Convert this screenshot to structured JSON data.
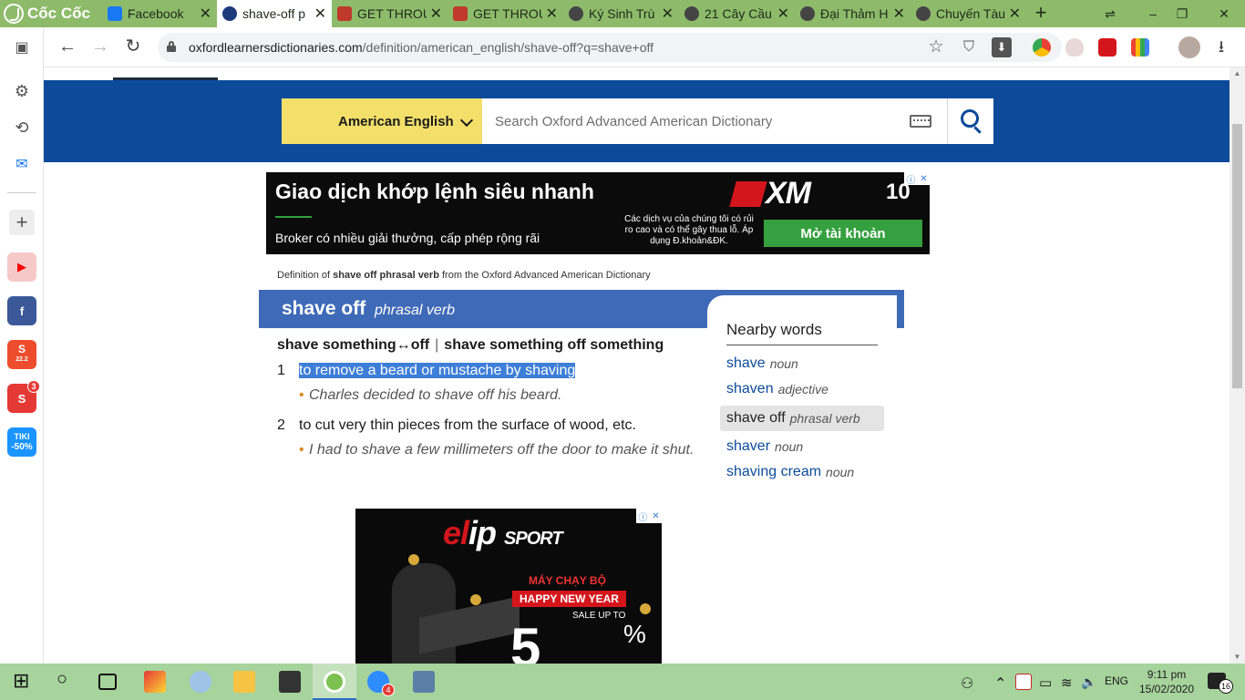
{
  "browser": {
    "name": "Cốc Cốc",
    "tabs": [
      {
        "title": "Facebook",
        "favicon_color": "#1877f2"
      },
      {
        "title": "shave-off p",
        "favicon_color": "#1d3a7a"
      },
      {
        "title": "GET THROU",
        "favicon_color": "#c0392b"
      },
      {
        "title": "GET THROU",
        "favicon_color": "#c0392b"
      },
      {
        "title": "Ký Sinh Trù",
        "favicon_color": "#444444"
      },
      {
        "title": "21 Cây Cầu",
        "favicon_color": "#444444"
      },
      {
        "title": "Đại Thảm H",
        "favicon_color": "#444444"
      },
      {
        "title": "Chuyến Tàu",
        "favicon_color": "#444444"
      }
    ],
    "active_tab": 1,
    "tab_close": "✕",
    "new_tab": "+",
    "window_controls": {
      "cast": "⇌",
      "minimize": "–",
      "restore": "❐",
      "close": "✕"
    },
    "url": {
      "host": "oxfordlearnersdictionaries.com",
      "path": "/definition/american_english/shave-off?q=shave+off"
    },
    "nav": {
      "back": "←",
      "forward": "→",
      "reload": "↻"
    },
    "omnibox_icons": {
      "star": "☆",
      "shield": "⛉",
      "download": "⬇"
    },
    "toolbar_download": "⭳"
  },
  "sidebar": {
    "items": [
      {
        "icon": "panel-icon",
        "glyph": "▣"
      },
      {
        "icon": "gear-icon",
        "glyph": "⚙"
      },
      {
        "icon": "history-icon",
        "glyph": "⟲"
      },
      {
        "icon": "messenger-icon",
        "glyph": "✉"
      },
      {
        "icon": "add-icon",
        "glyph": "+"
      }
    ],
    "apps": [
      {
        "name": "youtube",
        "color": "#ff0000",
        "glyph": "▶"
      },
      {
        "name": "facebook",
        "color": "#1877f2",
        "glyph": "f"
      },
      {
        "name": "shopee",
        "color": "#ee4d2d",
        "glyph": "S",
        "sub": "22.2"
      },
      {
        "name": "sendo",
        "color": "#e53935",
        "glyph": "S",
        "badge": "3"
      },
      {
        "name": "tiki",
        "color": "#1a94ff",
        "glyph": "TIKI",
        "sub": "-50%"
      }
    ]
  },
  "page": {
    "dictionary_select": "American English",
    "search_placeholder": "Search Oxford Advanced American Dictionary",
    "ad_top": {
      "headline": "Giao dịch khớp lệnh siêu nhanh",
      "sub": "Broker có nhiều giải thưởng, cấp phép rộng rãi",
      "brand": "XM",
      "years": "10",
      "small": "Các dịch vụ của chúng tôi có rủi ro cao và có thể gây thua lỗ. Áp dụng Đ.khoản&ĐK.",
      "cta": "Mở tài khoản",
      "close_info": "ⓘ",
      "close_x": "✕"
    },
    "source": {
      "prefix": "Definition of ",
      "term": "shave off phrasal verb",
      "suffix": " from the Oxford Advanced American Dictionary"
    },
    "headword": "shave off",
    "pos": "phrasal verb",
    "variants": {
      "first": "shave something↔off",
      "separator": "|",
      "second": "shave something off something"
    },
    "senses": [
      {
        "num": "1",
        "definition": "to remove a beard or mustache by shaving",
        "example": "Charles decided to shave off his beard."
      },
      {
        "num": "2",
        "definition": "to cut very thin pieces from the surface of wood, etc.",
        "example": "I had to shave a few millimeters off the door to make it shut."
      }
    ],
    "bullet": "•",
    "nearby": {
      "title": "Nearby words",
      "items": [
        {
          "word": "shave",
          "pos": "noun"
        },
        {
          "word": "shaven",
          "pos": "adjective"
        },
        {
          "word": "shave off",
          "pos": "phrasal verb"
        },
        {
          "word": "shaver",
          "pos": "noun"
        },
        {
          "word": "shaving cream",
          "pos": "noun"
        }
      ]
    },
    "ad_bottom": {
      "brand_a": "el",
      "brand_b": "ip",
      "brand_c": "SPORT",
      "line1": "MÁY CHẠY BỘ",
      "line2": "HAPPY NEW YEAR",
      "line3": "SALE UP TO",
      "big": "5",
      "pct": "%",
      "close_info": "ⓘ",
      "close_x": "✕"
    }
  },
  "taskbar": {
    "tray": {
      "language": "ENG",
      "time": "9:11 pm",
      "date": "15/02/2020",
      "notifications": "16",
      "zalo_badge": "4"
    },
    "glyphs": {
      "start": "⊞",
      "search": "○",
      "people": "⚇",
      "chevron": "⌃",
      "battery": "▭",
      "wifi": "≋",
      "volume": "🔈"
    }
  }
}
